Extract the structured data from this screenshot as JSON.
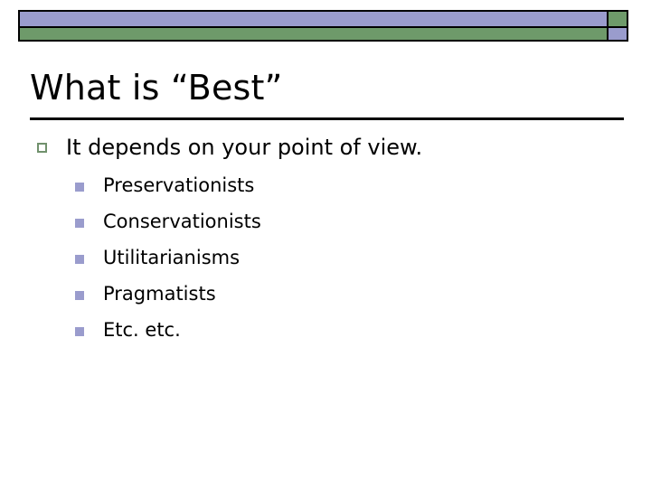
{
  "slide": {
    "title": "What is “Best”",
    "decoration": {
      "purple": "#9a9ccd",
      "green": "#6e9a6a",
      "outline": "#000000",
      "top_bar_name": "purple-bar",
      "bottom_bar_name": "green-bar",
      "accent_block_name": "corner-accent-block"
    },
    "rule_color": "#000000",
    "body": {
      "level1": [
        {
          "text": "It depends on your point of view.",
          "bullet_icon": "hollow-square-bullet-icon",
          "bullet_color": "#71916d"
        }
      ],
      "level2": [
        {
          "text": "Preservationists",
          "bullet_icon": "filled-square-bullet-icon",
          "bullet_color": "#9a9ccd"
        },
        {
          "text": "Conservationists",
          "bullet_icon": "filled-square-bullet-icon",
          "bullet_color": "#9a9ccd"
        },
        {
          "text": "Utilitarianisms",
          "bullet_icon": "filled-square-bullet-icon",
          "bullet_color": "#9a9ccd"
        },
        {
          "text": "Pragmatists",
          "bullet_icon": "filled-square-bullet-icon",
          "bullet_color": "#9a9ccd"
        },
        {
          "text": "Etc. etc.",
          "bullet_icon": "filled-square-bullet-icon",
          "bullet_color": "#9a9ccd"
        }
      ]
    }
  }
}
